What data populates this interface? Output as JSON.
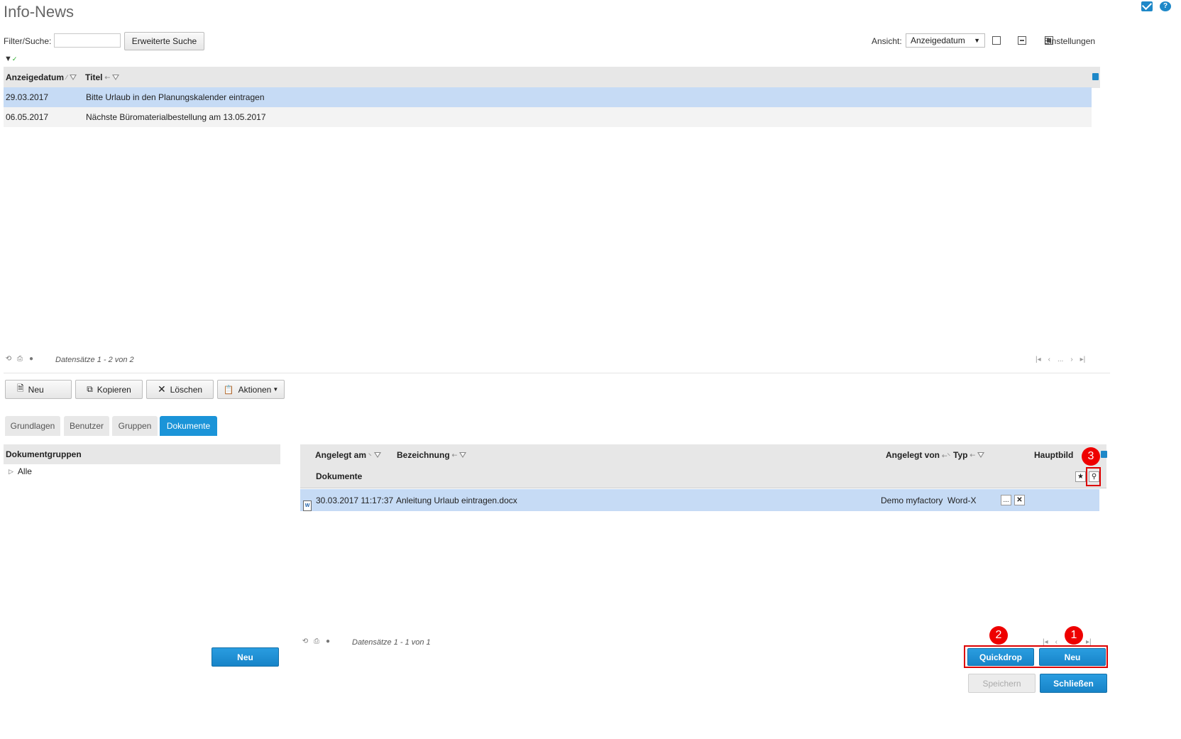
{
  "page": {
    "title": "Info-News"
  },
  "filter": {
    "label": "Filter/Suche:",
    "value": "",
    "advanced_search_label": "Erweiterte Suche"
  },
  "view": {
    "label": "Ansicht:",
    "selected": "Anzeigedatum",
    "settings_label": "Einstellungen"
  },
  "news_grid": {
    "columns": [
      "Anzeigedatum",
      "Titel"
    ],
    "rows": [
      {
        "date": "29.03.2017",
        "title": "Bitte Urlaub in den Planungskalender eintragen"
      },
      {
        "date": "06.05.2017",
        "title": "Nächste Büromaterialbestellung am 13.05.2017"
      }
    ],
    "record_info": "Datensätze 1 - 2 von 2",
    "pager_dots": "..."
  },
  "toolbar": {
    "new_label": "Neu",
    "copy_label": "Kopieren",
    "delete_label": "Löschen",
    "actions_label": "Aktionen"
  },
  "tabs": [
    "Grundlagen",
    "Benutzer",
    "Gruppen",
    "Dokumente"
  ],
  "doc_groups": {
    "header": "Dokumentgruppen",
    "items": [
      "Alle"
    ],
    "new_label": "Neu"
  },
  "documents": {
    "columns": {
      "created_at": "Angelegt am",
      "name": "Bezeichnung",
      "created_by": "Angelegt von",
      "type": "Typ",
      "main_image": "Hauptbild"
    },
    "subheader": "Dokumente",
    "rows": [
      {
        "created_at": "30.03.2017 11:17:37",
        "name": "Anleitung Urlaub eintragen.docx",
        "created_by": "Demo myfactory",
        "type": "Word-X",
        "more": "..."
      }
    ],
    "record_info": "Datensätze 1 - 1 von 1",
    "quickdrop_label": "Quickdrop",
    "new_label": "Neu"
  },
  "footer": {
    "save_label": "Speichern",
    "close_label": "Schließen"
  },
  "annotations": [
    "1",
    "2",
    "3"
  ],
  "colors": {
    "accent": "#1b94d8",
    "selected_row": "#c6dbf5",
    "annotation": "#e00000"
  }
}
